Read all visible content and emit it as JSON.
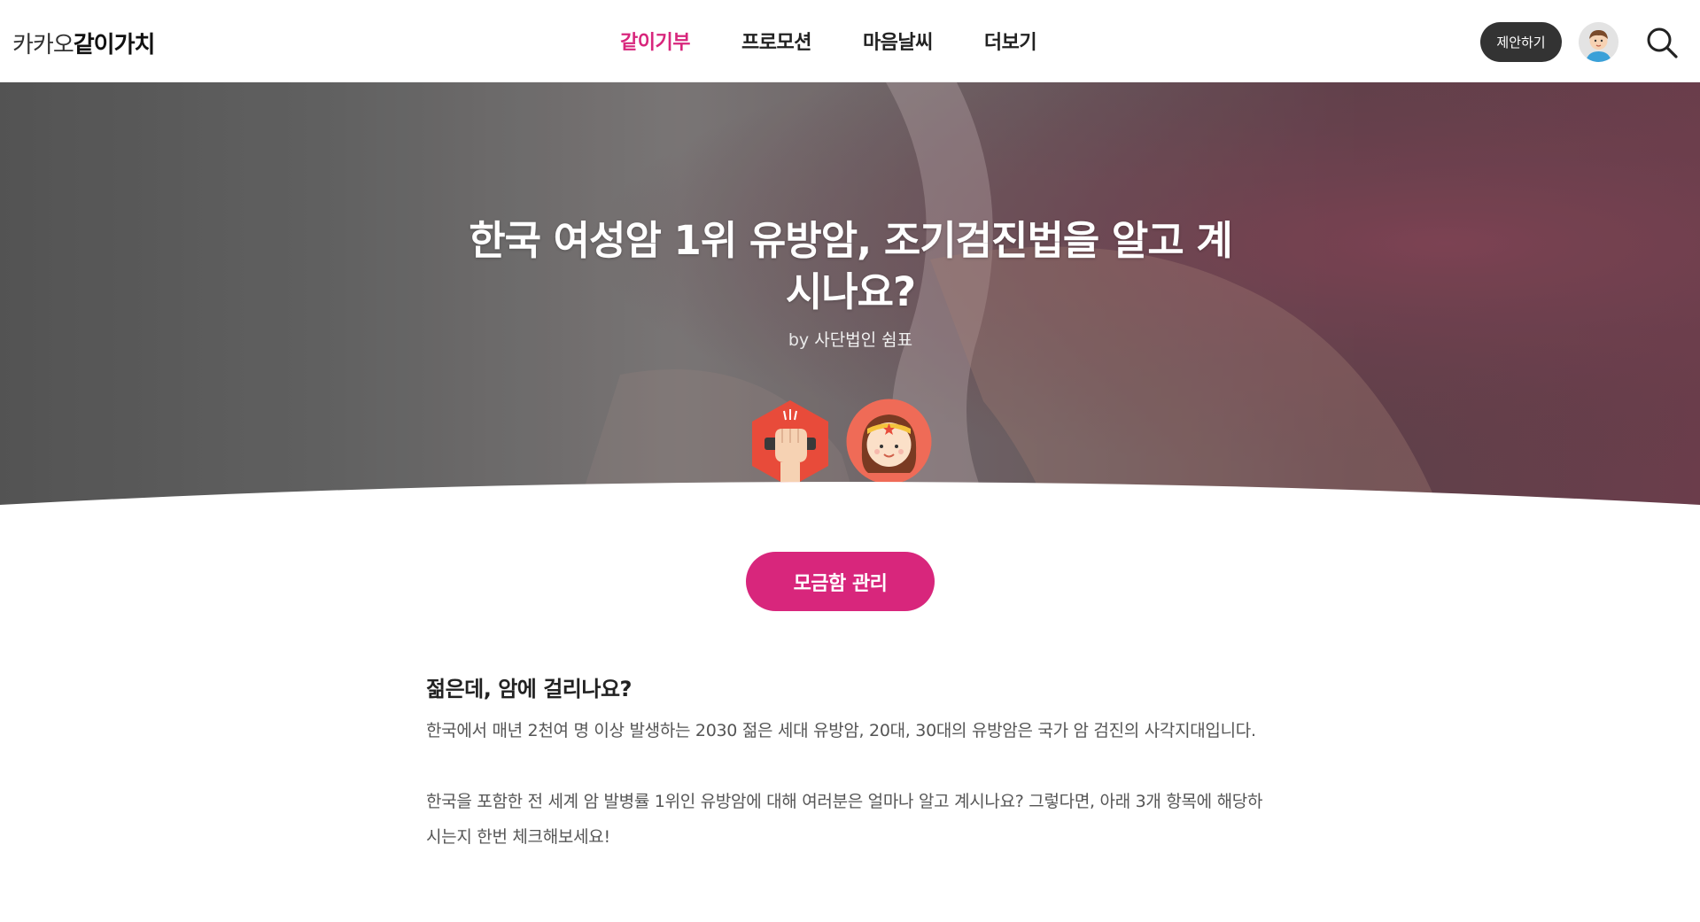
{
  "header": {
    "logo_light": "카카오",
    "logo_bold": "같이가치",
    "nav": [
      {
        "label": "같이기부",
        "active": true
      },
      {
        "label": "프로모션",
        "active": false
      },
      {
        "label": "마음날씨",
        "active": false
      },
      {
        "label": "더보기",
        "active": false
      }
    ],
    "propose_label": "제안하기",
    "accent_color": "#d8267c"
  },
  "hero": {
    "title": "한국 여성암 1위 유방암, 조기검진법을 알고 계시나요?",
    "by_prefix": "by",
    "organization": "사단법인 쉼표",
    "badges": [
      "fist-badge-icon",
      "heroine-badge-icon"
    ]
  },
  "manage_button": "모금함 관리",
  "content": {
    "heading": "젊은데, 암에 걸리나요?",
    "paragraphs": [
      "한국에서 매년 2천여 명 이상 발생하는 2030 젊은 세대 유방암, 20대, 30대의 유방암은 국가 암 검진의 사각지대입니다.",
      "한국을 포함한 전 세계 암 발병률 1위인 유방암에 대해 여러분은 얼마나 알고 계시나요? 그렇다면, 아래 3개 항목에 해당하시는지 한번 체크해보세요!"
    ]
  }
}
